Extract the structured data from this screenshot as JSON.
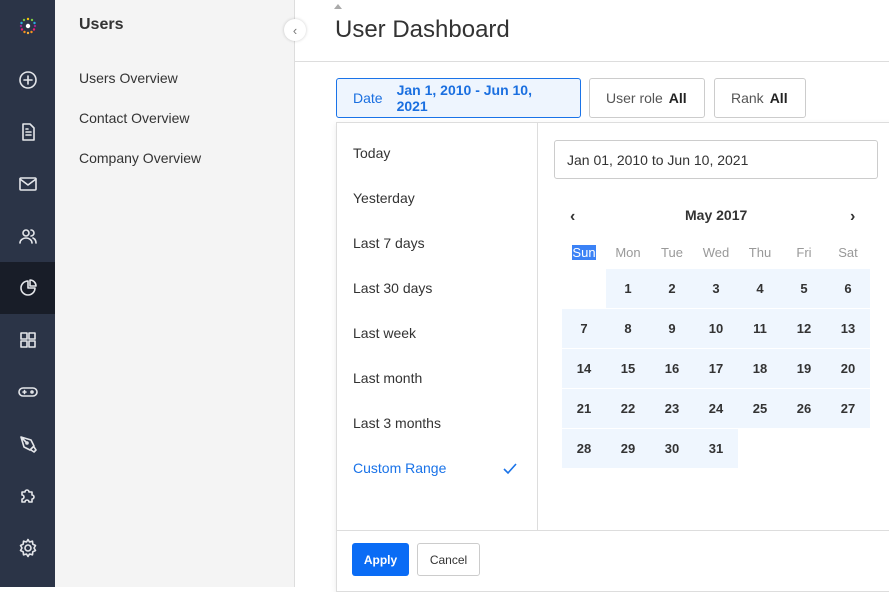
{
  "rail": {
    "icons": [
      "logo-icon",
      "plus-circle-icon",
      "document-icon",
      "mail-icon",
      "users-icon",
      "pie-chart-icon",
      "grid-icon",
      "gamepad-icon",
      "pen-tool-icon",
      "puzzle-icon",
      "gear-icon"
    ],
    "active": "pie-chart-icon"
  },
  "submenu": {
    "title": "Users",
    "items": [
      {
        "label": "Users Overview"
      },
      {
        "label": "Contact Overview"
      },
      {
        "label": "Company Overview"
      }
    ]
  },
  "header": {
    "title": "User Dashboard"
  },
  "filters": {
    "date": {
      "label": "Date",
      "value": "Jan 1, 2010 - Jun 10, 2021"
    },
    "role": {
      "label": "User role",
      "value": "All"
    },
    "rank": {
      "label": "Rank",
      "value": "All"
    }
  },
  "picker": {
    "ranges": [
      {
        "label": "Today"
      },
      {
        "label": "Yesterday"
      },
      {
        "label": "Last 7 days"
      },
      {
        "label": "Last 30 days"
      },
      {
        "label": "Last week"
      },
      {
        "label": "Last month"
      },
      {
        "label": "Last 3 months"
      },
      {
        "label": "Custom Range",
        "selected": true
      }
    ],
    "input_value": "Jan 01, 2010 to Jun 10, 2021",
    "month": "May 2017",
    "prev": "‹",
    "next": "›",
    "weekdays": [
      "Sun",
      "Mon",
      "Tue",
      "Wed",
      "Thu",
      "Fri",
      "Sat"
    ],
    "first_weekday": 1,
    "days_in_month": 31,
    "apply": "Apply",
    "cancel": "Cancel",
    "accent": "#1a73e8"
  }
}
